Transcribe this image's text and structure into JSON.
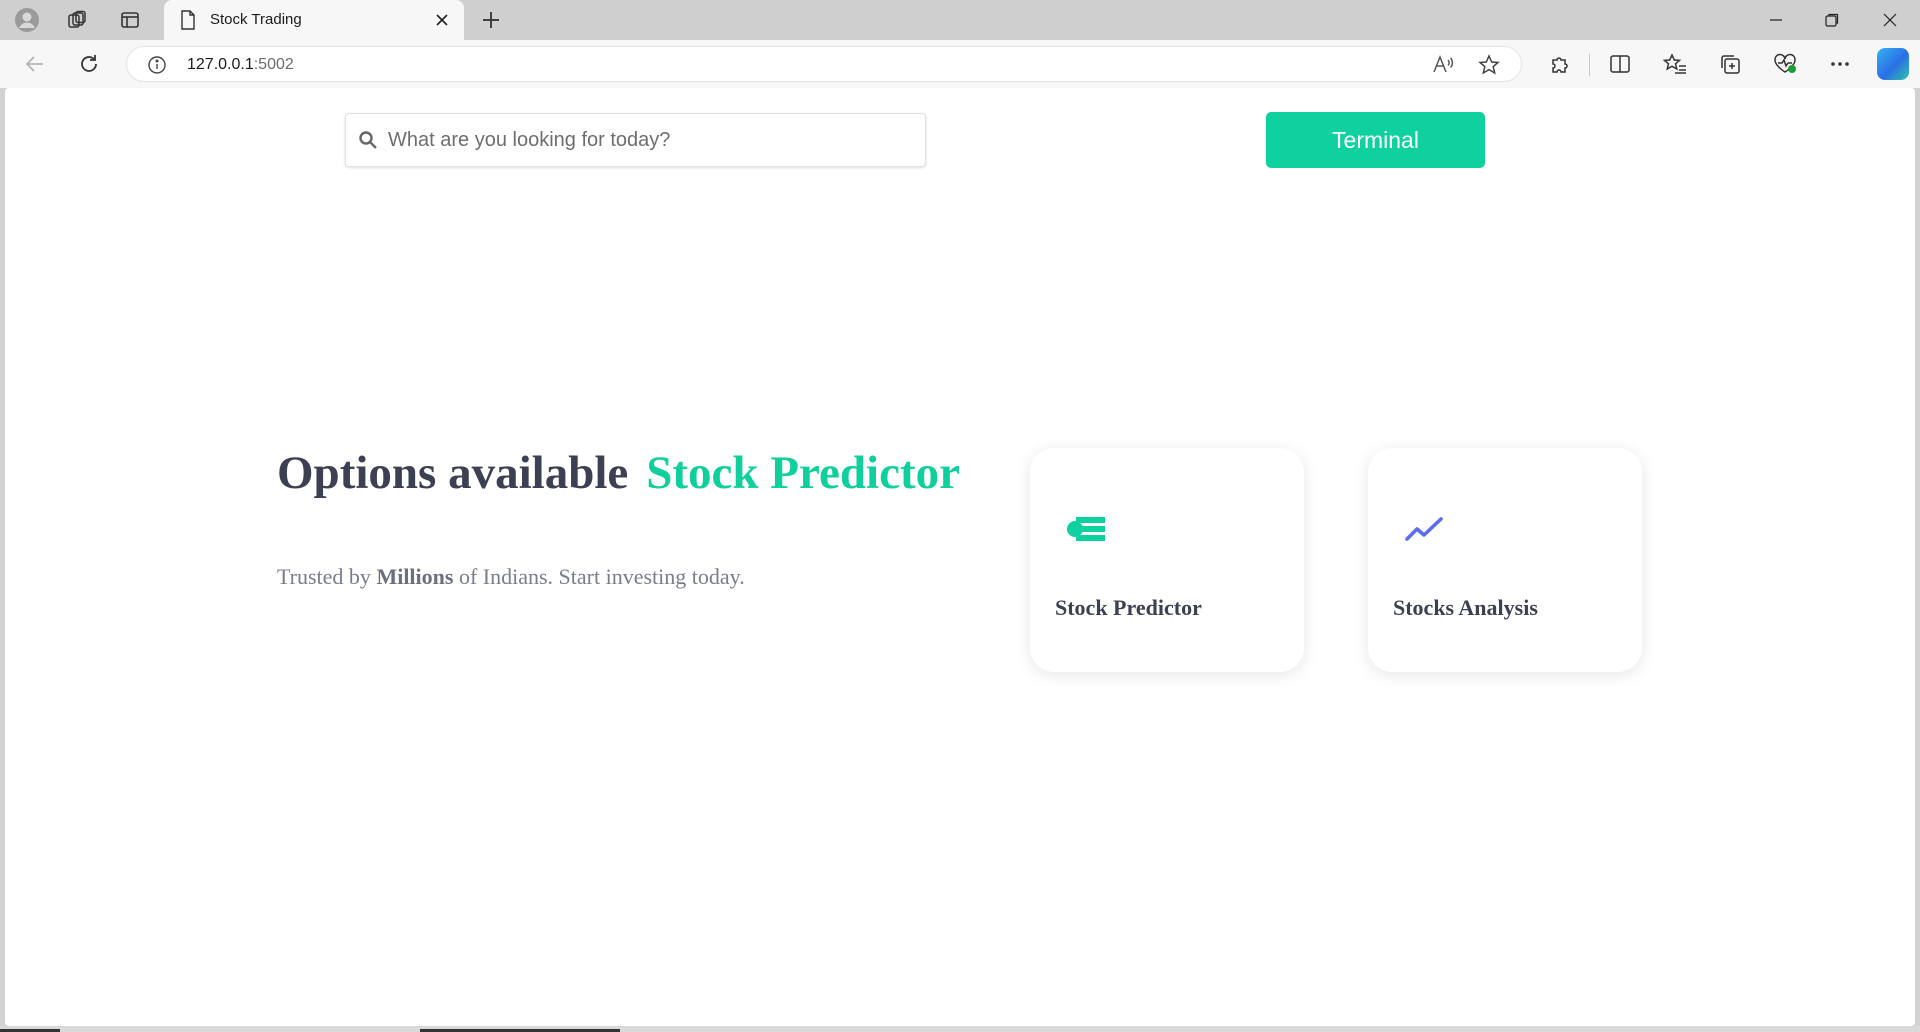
{
  "browser": {
    "tab_title": "Stock Trading",
    "address": {
      "host": "127.0.0.1",
      "port": ":5002"
    },
    "icons": {
      "profile": "profile-icon",
      "workspaces": "workspaces-icon",
      "vertical_tabs": "vertical-tabs-icon",
      "page": "page-icon",
      "close": "close-icon",
      "new_tab": "plus-icon",
      "back": "back-arrow-icon",
      "refresh": "refresh-icon",
      "site_info": "info-icon",
      "read_aloud": "read-aloud-icon",
      "favorite": "star-icon",
      "extensions": "puzzle-icon",
      "split_screen": "split-screen-icon",
      "favorites": "favorites-list-icon",
      "collections": "collections-icon",
      "browser_essentials": "heart-pulse-icon",
      "more": "more-icon",
      "copilot": "copilot-icon"
    }
  },
  "page": {
    "search": {
      "placeholder": "What are you looking for today?"
    },
    "terminal_button": "Terminal",
    "headline": {
      "part1": "Options available",
      "part2": "Stock Predictor"
    },
    "tagline": {
      "before": "Trusted by ",
      "bold": "Millions",
      "after": " of Indians. Start investing today."
    },
    "cards": [
      {
        "label": "Stock Predictor",
        "icon": "predictor-icon"
      },
      {
        "label": "Stocks Analysis",
        "icon": "trend-icon"
      }
    ],
    "colors": {
      "accent": "#0fd1a0",
      "heading": "#3d3f52",
      "analysis_icon": "#5b6cf0"
    }
  }
}
